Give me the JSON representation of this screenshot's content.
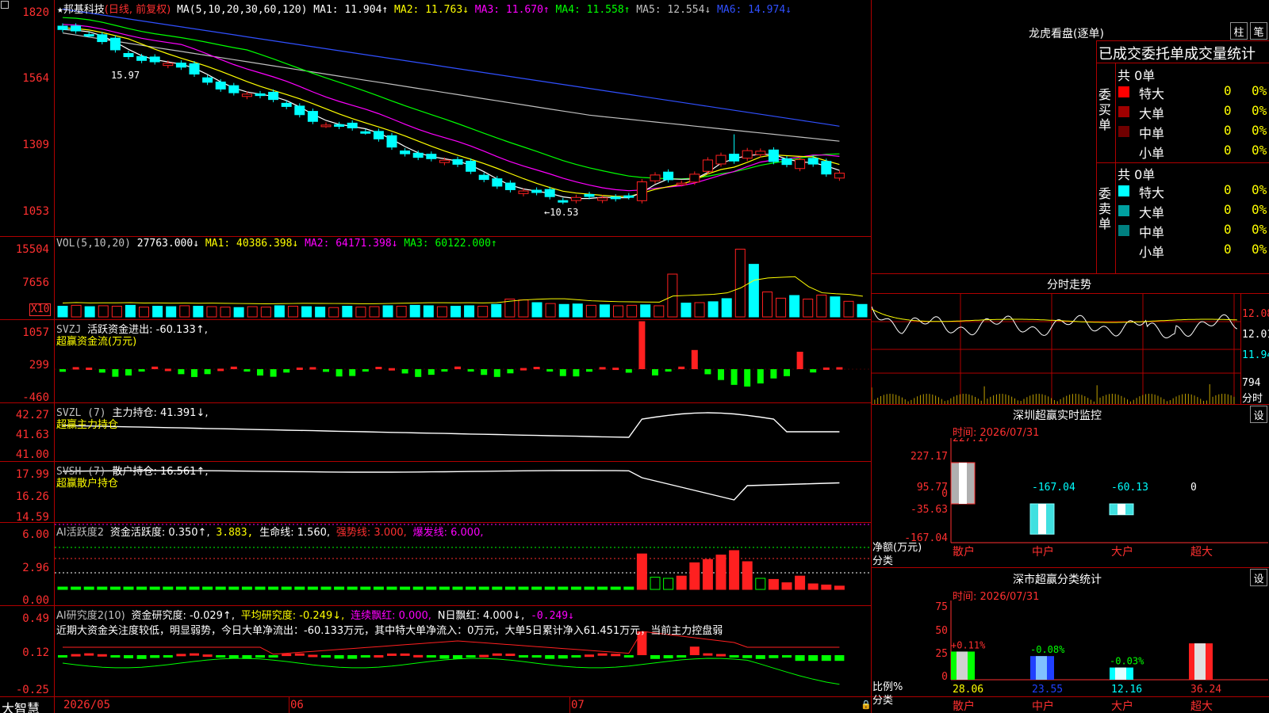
{
  "colors": {
    "up": "#ff2020",
    "down": "#00ffff",
    "panel_line": "#b00000",
    "ma1": "#ffffff",
    "ma2": "#ffff00",
    "ma3": "#ff00ff",
    "ma4": "#00ff00",
    "ma5": "#c0c0c0",
    "ma6": "#3050ff"
  },
  "main": {
    "star": "★",
    "stock_name": "邦基科技",
    "period": "(日线, 前复权)",
    "ma_params": "MA(5,10,20,30,60,120)",
    "ma1": "MA1: 11.904↑",
    "ma2": "MA2: 11.763↓",
    "ma3": "MA3: 11.670↑",
    "ma4": "MA4: 11.558↑",
    "ma5": "MA5: 12.554↓",
    "ma6": "MA6: 14.974↓",
    "y_ticks": [
      "1820",
      "1564",
      "1309",
      "1053"
    ],
    "high_label": "15.97",
    "low_label": "←10.53",
    "y_range": [
      1000,
      1850
    ]
  },
  "vol": {
    "title": "VOL(5,10,20)",
    "value": "27763.000↓",
    "ma1": "MA1: 40386.398↓",
    "ma2": "MA2: 64171.398↓",
    "ma3": "MA3: 60122.000↑",
    "y_ticks": [
      "15504",
      "7656"
    ],
    "unit": "X10",
    "bars": [
      2.4,
      2.6,
      2.3,
      2.5,
      2.4,
      2.6,
      2.2,
      2.4,
      2.3,
      2.5,
      2.4,
      2.3,
      2.2,
      2.1,
      2.3,
      2.2,
      2.5,
      2.4,
      2.3,
      2.2,
      2.1,
      2.4,
      2.2,
      2.3,
      2.5,
      2.4,
      2.6,
      2.5,
      2.3,
      2.4,
      2.5,
      2.4,
      2.8,
      4.0,
      3.8,
      3.2,
      3.0,
      2.8,
      2.9,
      2.6,
      2.7,
      2.5,
      2.6,
      2.7,
      2.5,
      9.6,
      3.1,
      3.2,
      3.4,
      4.1,
      15.2,
      11.8,
      5.6,
      4.2,
      4.8,
      4.0,
      4.9,
      4.5,
      3.5,
      2.8
    ]
  },
  "svzj": {
    "title": "SVZJ",
    "label": "活跃资金进出: -60.133↑,",
    "label2": "超赢资金流(万元)",
    "y_ticks": [
      "1057",
      "299",
      "-460"
    ]
  },
  "svzl": {
    "title": "SVZL (7)",
    "label": "主力持仓: 41.391↓,",
    "label2": "超赢主力持仓",
    "y_ticks": [
      "42.27",
      "41.63",
      "41.00"
    ]
  },
  "svsh": {
    "title": "SVSH (7)",
    "label": "散户持仓: 16.561↑,",
    "label2": "超赢散户持仓",
    "y_ticks": [
      "17.99",
      "16.26",
      "14.59"
    ]
  },
  "ai1": {
    "title": "AI活跃度2",
    "label": "资金活跃度: 0.350↑,",
    "v2": "3.883,",
    "life": "生命线: 1.560,",
    "strong": "强势线: 3.000,",
    "burst": "爆发线: 6.000,",
    "y_ticks": [
      "6.00",
      "2.96",
      "0.00"
    ]
  },
  "ai2": {
    "title": "AI研究度2(10)",
    "label": "资金研究度: -0.029↑,",
    "avg": "平均研究度: -0.249↓,",
    "red": "连续飘红: 0.000,",
    "nred": "N日飘红: 4.000↓,",
    "extra": "-0.249↓",
    "note": "近期大资金关注度较低，明显弱势，今日大单净流出：-60.133万元，其中特大单净流入：0万元，大单5日累计净入61.451万元，当前主力控盘弱",
    "y_ticks": [
      "0.49",
      "0.12",
      "-0.25"
    ]
  },
  "footer": {
    "app": "大智慧",
    "date1": "2026/05",
    "date2": "06",
    "date3": "07"
  },
  "right": {
    "dragon_title": "龙虎看盘(逐单)",
    "btn_zhu": "柱",
    "btn_bi": "笔",
    "stat_title": "已成交委托单成交量统计",
    "buy": {
      "side": "委买单",
      "total": "共 0单",
      "rows": [
        {
          "name": "特大",
          "v": "0",
          "p": "0%"
        },
        {
          "name": "大单",
          "v": "0",
          "p": "0%"
        },
        {
          "name": "中单",
          "v": "0",
          "p": "0%"
        },
        {
          "name": "小单",
          "v": "0",
          "p": "0%"
        }
      ]
    },
    "sell": {
      "side": "委卖单",
      "total": "共 0单",
      "rows": [
        {
          "name": "特大",
          "v": "0",
          "p": "0%"
        },
        {
          "name": "大单",
          "v": "0",
          "p": "0%"
        },
        {
          "name": "中单",
          "v": "0",
          "p": "0%"
        },
        {
          "name": "小单",
          "v": "0",
          "p": "0%"
        }
      ]
    },
    "intraday": {
      "title": "分时走势",
      "p1": "12.08",
      "p2": "12.01",
      "p3": "11.94",
      "vol": "794",
      "unit": "分时"
    },
    "monitor": {
      "title": "深圳超赢实时监控",
      "time": "时间: 2026/07/31",
      "set": "设",
      "y_ticks": [
        "227.17",
        "95.77",
        "-35.63",
        "-167.04"
      ],
      "y_unit": "净额(万元)",
      "x_unit": "分类",
      "categories": [
        "散户",
        "中户",
        "大户",
        "超大"
      ],
      "values": [
        227.17,
        -167.04,
        -60.13,
        0
      ],
      "value_labels": [
        "227.17",
        "-167.04",
        "-60.13",
        "0"
      ],
      "zero": "0"
    },
    "classify": {
      "title": "深市超赢分类统计",
      "time": "时间: 2026/07/31",
      "set": "设",
      "y_ticks": [
        "75",
        "50",
        "25",
        "0"
      ],
      "y_unit": "比例%",
      "x_unit": "分类",
      "categories": [
        "散户",
        "中户",
        "大户",
        "超大"
      ],
      "values": [
        28.06,
        23.55,
        12.16,
        36.24
      ],
      "changes": [
        "+0.11%",
        "-0.08%",
        "-0.03%",
        ""
      ]
    }
  }
}
